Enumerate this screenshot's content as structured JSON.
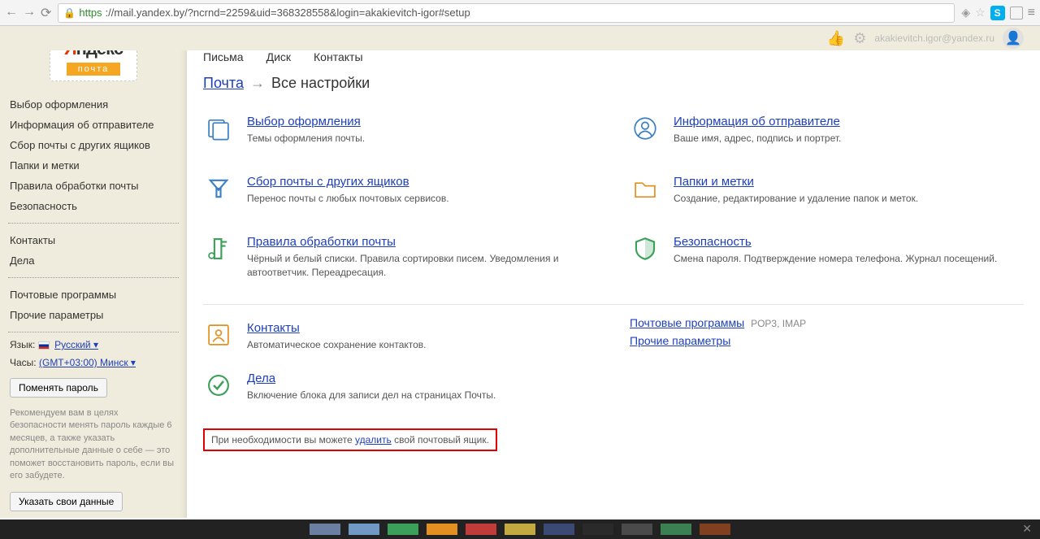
{
  "browser": {
    "url": "https://mail.yandex.by/?ncrnd=2259&uid=368328558&login=akakievitch-igor#setup",
    "https_prefix": "https",
    "url_rest": "://mail.yandex.by/?ncrnd=2259&uid=368328558&login=akakievitch-igor#setup"
  },
  "header": {
    "user_email": "akakievitch.igor@yandex.ru"
  },
  "logo": {
    "brand_prefix": "Я",
    "brand_rest": "ндекс",
    "service": "почта"
  },
  "topnav": {
    "items": [
      "Письма",
      "Диск",
      "Контакты"
    ]
  },
  "breadcrumb": {
    "root": "Почта",
    "arrow": "→",
    "current": "Все настройки"
  },
  "sidebar": {
    "group1": [
      "Выбор оформления",
      "Информация об отправителе",
      "Сбор почты с других ящиков",
      "Папки и метки",
      "Правила обработки почты",
      "Безопасность"
    ],
    "group2": [
      "Контакты",
      "Дела"
    ],
    "group3": [
      "Почтовые программы",
      "Прочие параметры"
    ],
    "lang_label": "Язык:",
    "lang_value": "Русский ▾",
    "tz_label": "Часы:",
    "tz_value": "(GMT+03:00) Минск ▾",
    "change_pwd_btn": "Поменять пароль",
    "note": "Рекомендуем вам в целях безопасности менять пароль каждые 6 месяцев, а также указать дополнительные данные о себе — это поможет восстановить пароль, если вы его забудете.",
    "set_data_btn": "Указать свои данные"
  },
  "settings": [
    {
      "title": "Выбор оформления",
      "desc": "Темы оформления почты.",
      "icon": "theme"
    },
    {
      "title": "Информация об отправителе",
      "desc": "Ваше имя, адрес, подпись и портрет.",
      "icon": "sender"
    },
    {
      "title": "Сбор почты с других ящиков",
      "desc": "Перенос почты с любых почтовых сервисов.",
      "icon": "collect"
    },
    {
      "title": "Папки и метки",
      "desc": "Создание, редактирование и удаление папок и меток.",
      "icon": "folder"
    },
    {
      "title": "Правила обработки почты",
      "desc": "Чёрный и белый списки. Правила сортировки писем. Уведомления и автоответчик. Переадресация.",
      "icon": "rules"
    },
    {
      "title": "Безопасность",
      "desc": "Смена пароля. Подтверждение номера телефона. Журнал посещений.",
      "icon": "security"
    }
  ],
  "extras": {
    "contacts_title": "Контакты",
    "contacts_desc": "Автоматическое сохранение контактов.",
    "todo_title": "Дела",
    "todo_desc": "Включение блока для записи дел на страницах Почты.",
    "programs": "Почтовые программы",
    "protocols": "POP3, IMAP",
    "other": "Прочие параметры"
  },
  "delete": {
    "prefix": "При необходимости вы можете ",
    "link": "удалить",
    "suffix": " свой почтовый ящик."
  },
  "footer_colors": [
    "#6b7fa3",
    "#7099c6",
    "#3aa05a",
    "#e39020",
    "#c23b3b",
    "#c4a840",
    "#3b4a75",
    "#2a2a2a",
    "#4a4a4a",
    "#3a8050",
    "#804020"
  ]
}
